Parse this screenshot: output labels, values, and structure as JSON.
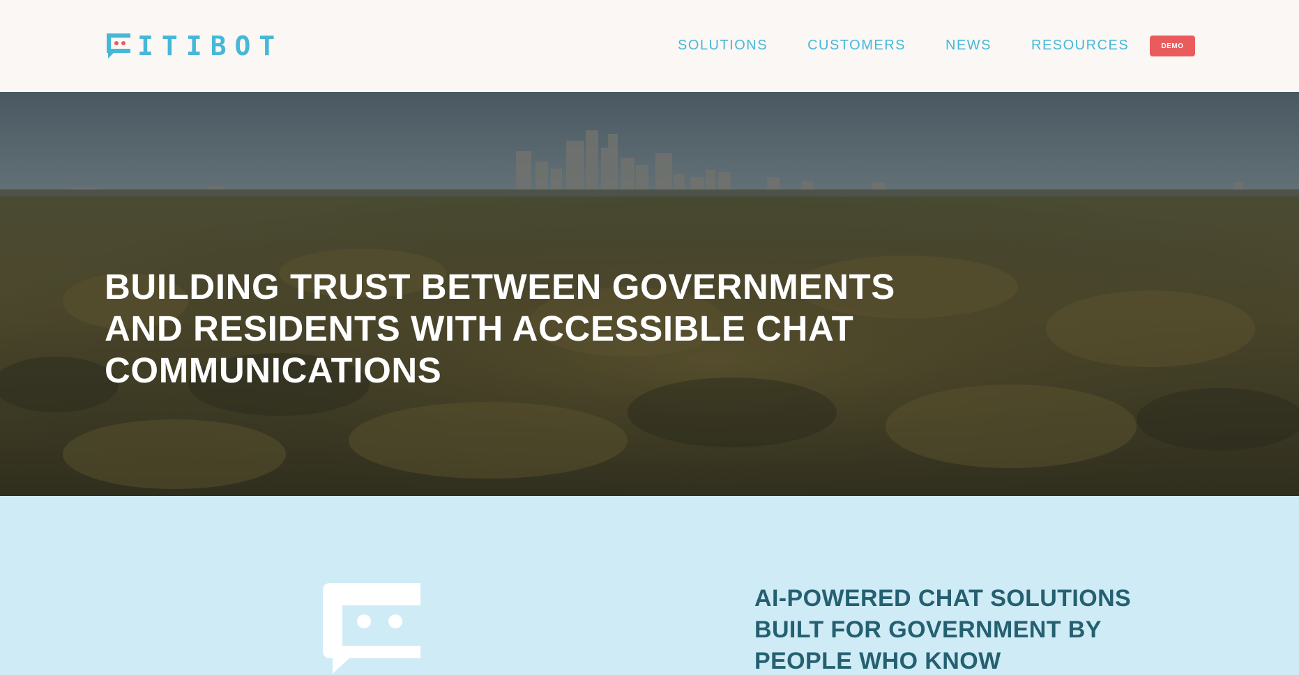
{
  "header": {
    "logo_text": "ITIBOT",
    "logo_icon": "chat-bubble-logo-icon",
    "nav": [
      {
        "label": "SOLUTIONS"
      },
      {
        "label": "CUSTOMERS"
      },
      {
        "label": "NEWS"
      },
      {
        "label": "RESOURCES"
      }
    ],
    "demo_label": "DEMO"
  },
  "hero": {
    "title_lines": [
      "BUILDING TRUST BETWEEN GOVERNMENTS",
      "AND RESIDENTS WITH ACCESSIBLE CHAT",
      "COMMUNICATIONS"
    ]
  },
  "feature": {
    "icon": "chat-bubble-icon",
    "title_lines": [
      "AI-POWERED CHAT SOLUTIONS",
      "BUILT FOR GOVERNMENT BY",
      "PEOPLE WHO KNOW"
    ]
  },
  "colors": {
    "brand_blue": "#45b8d8",
    "demo_red": "#ea5b5d",
    "feature_bg": "#cfebf5",
    "feature_title": "#246070",
    "header_bg": "#fbf7f5"
  }
}
